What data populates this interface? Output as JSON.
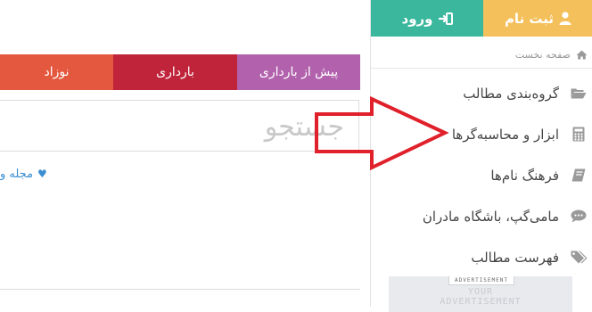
{
  "tabs": {
    "newborn": "نوزاد",
    "pregnancy": "بارداری",
    "pre_pregnancy": "پیش از بارداری"
  },
  "search": {
    "placeholder": "جستجو"
  },
  "magazine_link": "مجله و",
  "auth": {
    "login": "ورود",
    "register": "ثبت نام"
  },
  "breadcrumb": {
    "home": "صفحه نخست"
  },
  "menu": [
    {
      "label": "گروه‌بندی مطالب",
      "icon": "folder-icon"
    },
    {
      "label": "ابزار و محاسبه‌گرها",
      "icon": "calculator-icon"
    },
    {
      "label": "فرهنگ نام‌ها",
      "icon": "book-icon"
    },
    {
      "label": "مامی‌گپ، باشگاه مادران",
      "icon": "chat-icon"
    },
    {
      "label": "فهرست مطالب",
      "icon": "tags-icon"
    }
  ],
  "ad": {
    "tag": "ADVERTISEMENT",
    "line1": "YOUR",
    "line2": "ADVERTISEMENT"
  },
  "colors": {
    "newborn": "#e3583e",
    "pregnancy": "#c0243a",
    "pre_pregnancy": "#b262ad",
    "login": "#3ab79d",
    "register": "#f4c05b",
    "arrow": "#e0202a",
    "link": "#3b8fd1"
  }
}
